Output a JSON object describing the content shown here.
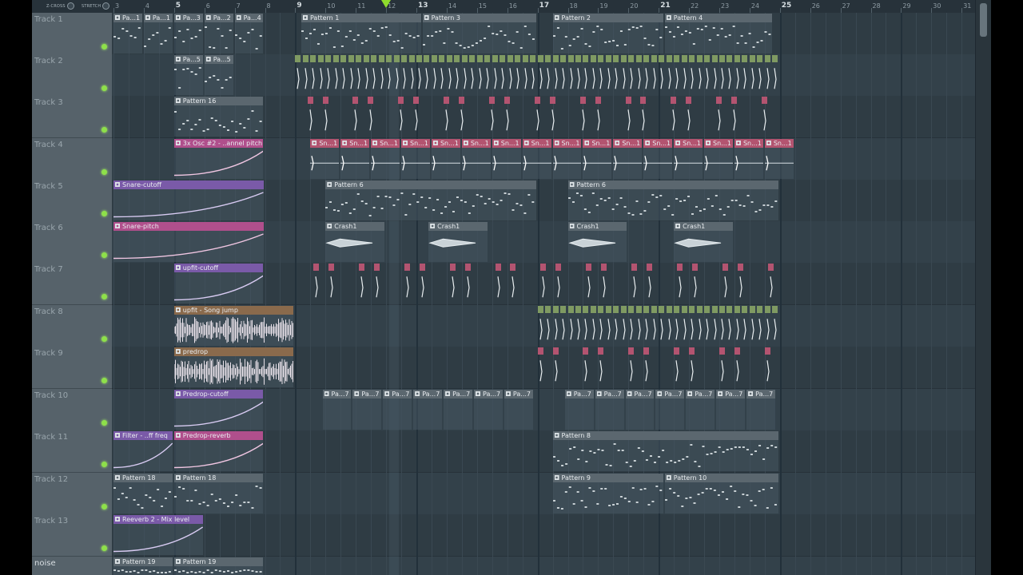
{
  "toolbar": {
    "zcross_label": "Z-CROSS",
    "stretch_label": "STRETCH"
  },
  "timeline": {
    "bars": [
      "3",
      "4",
      "5",
      "6",
      "7",
      "8",
      "9",
      "10",
      "11",
      "12",
      "13",
      "14",
      "15",
      "16",
      "17",
      "18",
      "19",
      "20",
      "21",
      "22",
      "23",
      "24",
      "25",
      "26",
      "27",
      "28",
      "29",
      "30",
      "31"
    ],
    "major_bars": [
      "5",
      "9",
      "13",
      "17",
      "21",
      "25"
    ],
    "song_position_bar": 12
  },
  "tracks": [
    {
      "name": "Track 1",
      "led": true
    },
    {
      "name": "Track 2",
      "led": true
    },
    {
      "name": "Track 3",
      "led": true
    },
    {
      "name": "Track 4",
      "led": true
    },
    {
      "name": "Track 5",
      "led": true
    },
    {
      "name": "Track 6",
      "led": true
    },
    {
      "name": "Track 7",
      "led": true
    },
    {
      "name": "Track 8",
      "led": true
    },
    {
      "name": "Track 9",
      "led": true
    },
    {
      "name": "Track 10",
      "led": true
    },
    {
      "name": "Track 11",
      "led": true
    },
    {
      "name": "Track 12",
      "led": true
    },
    {
      "name": "Track 13",
      "led": true
    },
    {
      "name": "noise",
      "led": false
    }
  ],
  "clips": [
    {
      "track": 0,
      "bar": 3,
      "len": 1,
      "label": "Pa...1",
      "kind": "pattern"
    },
    {
      "track": 0,
      "bar": 4,
      "len": 1,
      "label": "Pa...1",
      "kind": "pattern"
    },
    {
      "track": 0,
      "bar": 5,
      "len": 1,
      "label": "Pa...3",
      "kind": "pattern"
    },
    {
      "track": 0,
      "bar": 6,
      "len": 1,
      "label": "Pa...2",
      "kind": "pattern"
    },
    {
      "track": 0,
      "bar": 7,
      "len": 1,
      "label": "Pa...4",
      "kind": "pattern"
    },
    {
      "track": 0,
      "bar": 9.2,
      "len": 4,
      "label": "Pattern 1",
      "kind": "pattern"
    },
    {
      "track": 0,
      "bar": 13.2,
      "len": 3.8,
      "label": "Pattern 3",
      "kind": "pattern"
    },
    {
      "track": 0,
      "bar": 17.5,
      "len": 3.7,
      "label": "Pattern 2",
      "kind": "pattern"
    },
    {
      "track": 0,
      "bar": 21.2,
      "len": 3.6,
      "label": "Pattern 4",
      "kind": "pattern"
    },
    {
      "track": 1,
      "bar": 5,
      "len": 1,
      "label": "Pa...5",
      "kind": "pattern"
    },
    {
      "track": 1,
      "bar": 6,
      "len": 1,
      "label": "Pa...5",
      "kind": "pattern"
    },
    {
      "track": 1,
      "bar": 9,
      "len": 16,
      "label": "",
      "kind": "audio-green-hits"
    },
    {
      "track": 2,
      "bar": 5,
      "len": 3,
      "label": "Pattern 16",
      "kind": "pattern"
    },
    {
      "track": 2,
      "bar": 9.4,
      "len": 15.6,
      "label": "",
      "kind": "audio-red-hits"
    },
    {
      "track": 3,
      "bar": 5,
      "len": 3,
      "label": "3x Osc #2 - ..annel pitch",
      "kind": "auto-pink"
    },
    {
      "track": 3,
      "bar": 9.5,
      "len": 16.2,
      "label": "Sn...1",
      "kind": "sn-repeat"
    },
    {
      "track": 4,
      "bar": 3,
      "len": 5,
      "label": "Snare-cutoff",
      "kind": "auto-purple"
    },
    {
      "track": 4,
      "bar": 10,
      "len": 7,
      "label": "Pattern 6",
      "kind": "pattern"
    },
    {
      "track": 4,
      "bar": 18,
      "len": 7,
      "label": "Pattern 6",
      "kind": "pattern"
    },
    {
      "track": 5,
      "bar": 3,
      "len": 5,
      "label": "Snare-pitch",
      "kind": "auto-pink"
    },
    {
      "track": 5,
      "bar": 10,
      "len": 2,
      "label": "Crash1",
      "kind": "audio-grey"
    },
    {
      "track": 5,
      "bar": 13.4,
      "len": 2,
      "label": "Crash1",
      "kind": "audio-grey"
    },
    {
      "track": 5,
      "bar": 18,
      "len": 2,
      "label": "Crash1",
      "kind": "audio-grey"
    },
    {
      "track": 5,
      "bar": 21.5,
      "len": 2,
      "label": "Crash1",
      "kind": "audio-grey"
    },
    {
      "track": 6,
      "bar": 5,
      "len": 3,
      "label": "upfit-cutoff",
      "kind": "auto-purple"
    },
    {
      "track": 6,
      "bar": 9.6,
      "len": 15.6,
      "label": "",
      "kind": "audio-red-hits"
    },
    {
      "track": 7,
      "bar": 5,
      "len": 4,
      "label": "upfit - Song jump",
      "kind": "audio-wave"
    },
    {
      "track": 7,
      "bar": 17,
      "len": 8,
      "label": "",
      "kind": "audio-green-hits"
    },
    {
      "track": 8,
      "bar": 5,
      "len": 4,
      "label": "predrop",
      "kind": "audio-wave"
    },
    {
      "track": 8,
      "bar": 17,
      "len": 8,
      "label": "",
      "kind": "audio-red-hits"
    },
    {
      "track": 9,
      "bar": 5,
      "len": 3,
      "label": "Predrop-cutoff",
      "kind": "auto-purple"
    },
    {
      "track": 9,
      "bar": 9.9,
      "len": 7,
      "label": "Pa...7",
      "kind": "pa7-repeat"
    },
    {
      "track": 9,
      "bar": 17.9,
      "len": 7,
      "label": "Pa...7",
      "kind": "pa7-repeat"
    },
    {
      "track": 10,
      "bar": 3,
      "len": 2,
      "label": "Filter - ..ff freq",
      "kind": "auto-purple"
    },
    {
      "track": 10,
      "bar": 5,
      "len": 3,
      "label": "Predrop-reverb",
      "kind": "auto-pink"
    },
    {
      "track": 10,
      "bar": 17.5,
      "len": 7.5,
      "label": "Pattern 8",
      "kind": "pattern"
    },
    {
      "track": 11,
      "bar": 3,
      "len": 2,
      "label": "Pattern 18",
      "kind": "pattern"
    },
    {
      "track": 11,
      "bar": 5,
      "len": 3,
      "label": "Pattern 18",
      "kind": "pattern"
    },
    {
      "track": 11,
      "bar": 17.5,
      "len": 3.7,
      "label": "Pattern 9",
      "kind": "pattern"
    },
    {
      "track": 11,
      "bar": 21.2,
      "len": 3.8,
      "label": "Pattern 10",
      "kind": "pattern"
    },
    {
      "track": 12,
      "bar": 3,
      "len": 3,
      "label": "Reeverb 2 - Mix level",
      "kind": "auto-purple"
    },
    {
      "track": 13,
      "bar": 3,
      "len": 2,
      "label": "Pattern 19",
      "kind": "pattern"
    },
    {
      "track": 13,
      "bar": 5,
      "len": 3,
      "label": "Pattern 19",
      "kind": "pattern"
    }
  ],
  "colors": {
    "background": "#2f3c44",
    "header": "#56626a",
    "led": "#8ee04a",
    "song_position": "#8fdc2c"
  }
}
